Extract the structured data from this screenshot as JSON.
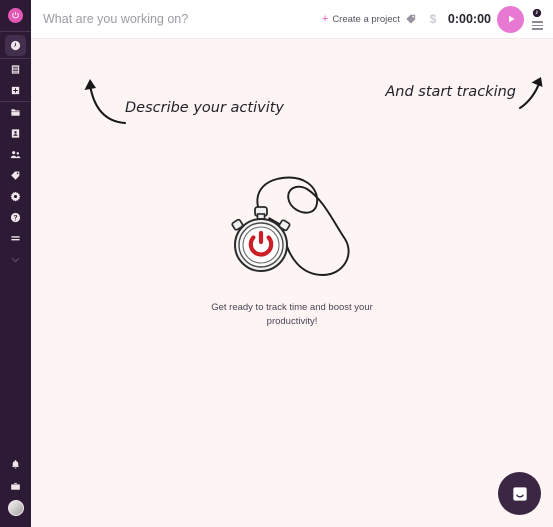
{
  "app": {
    "brand_color": "#e357b5",
    "sidebar_color": "#2d1b36",
    "background_color": "#fdf4f4",
    "play_button_color": "#e879d2",
    "logo_icon": "power-circle-icon"
  },
  "sidebar": {
    "logo_label": "Clockify",
    "groups": [
      {
        "name": "tracker",
        "items": [
          {
            "label": "Time Tracker",
            "icon": "clock-icon",
            "active": true
          }
        ]
      },
      {
        "name": "reports",
        "items": [
          {
            "label": "Reports",
            "icon": "document-icon",
            "active": false
          },
          {
            "label": "Dashboard",
            "icon": "dashboard-icon",
            "active": false
          }
        ]
      },
      {
        "name": "manage",
        "items": [
          {
            "label": "Projects",
            "icon": "folder-icon",
            "active": false
          },
          {
            "label": "Clients",
            "icon": "contact-card-icon",
            "active": false
          },
          {
            "label": "Team",
            "icon": "people-icon",
            "active": false
          },
          {
            "label": "Tags",
            "icon": "tag-icon",
            "active": false
          },
          {
            "label": "Settings",
            "icon": "gear-icon",
            "active": false
          },
          {
            "label": "Help",
            "icon": "question-circle-icon",
            "active": false
          },
          {
            "label": "More",
            "icon": "list-lines-icon",
            "active": false
          },
          {
            "label": "Expand",
            "icon": "chevron-down-icon",
            "active": false
          }
        ]
      }
    ],
    "bottom_items": [
      {
        "label": "Notifications",
        "icon": "bell-icon"
      },
      {
        "label": "Workspace",
        "icon": "briefcase-icon"
      },
      {
        "label": "Profile",
        "icon": "avatar"
      }
    ]
  },
  "header": {
    "task_placeholder": "What are you working on?",
    "task_value": "",
    "create_project_label": "Create a project",
    "create_project_plus": "+",
    "tag_icon": "tag-icon",
    "billable_symbol": "$",
    "timer_value": "0:00:00",
    "play_icon": "play-icon",
    "mini_clock_icon": "clock-icon",
    "menu_icon": "hamburger-menu-icon"
  },
  "main": {
    "illustration": "stopwatch-with-lanyard",
    "caption": "Get ready to track time and boost your productivity!"
  },
  "annotations": {
    "left": {
      "text": "Describe your activity",
      "arrow": "curved-arrow-up-left"
    },
    "right": {
      "text": "And start tracking",
      "arrow": "arrow-up-right"
    }
  },
  "chat": {
    "label": "Open chat",
    "icon": "chat-smile-icon"
  }
}
